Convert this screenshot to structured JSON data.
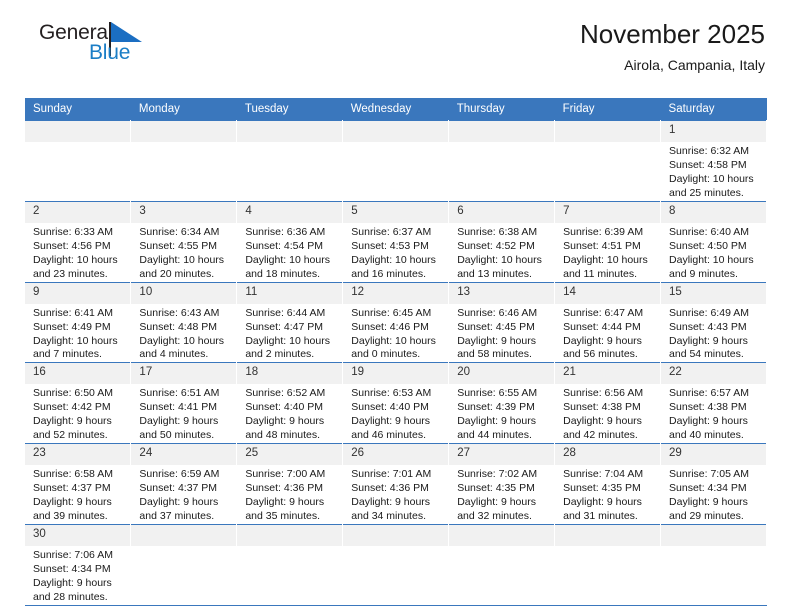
{
  "brand": {
    "name_top": "General",
    "name_bottom": "Blue",
    "accent_color": "#1b7ec6",
    "flag_icon": "general-blue-flag"
  },
  "header": {
    "title": "November 2025",
    "subtitle": "Airola, Campania, Italy"
  },
  "colors": {
    "header_blue": "#3a77bd",
    "daynum_gray": "#f1f1f1",
    "text": "#1a1a1a"
  },
  "weekdays": [
    "Sunday",
    "Monday",
    "Tuesday",
    "Wednesday",
    "Thursday",
    "Friday",
    "Saturday"
  ],
  "labels": {
    "sunrise": "Sunrise:",
    "sunset": "Sunset:",
    "daylight": "Daylight:"
  },
  "weeks": [
    [
      {
        "blank": true
      },
      {
        "blank": true
      },
      {
        "blank": true
      },
      {
        "blank": true
      },
      {
        "blank": true
      },
      {
        "blank": true
      },
      {
        "day": "1",
        "sunrise": "Sunrise: 6:32 AM",
        "sunset": "Sunset: 4:58 PM",
        "daylight1": "Daylight: 10 hours",
        "daylight2": "and 25 minutes."
      }
    ],
    [
      {
        "day": "2",
        "sunrise": "Sunrise: 6:33 AM",
        "sunset": "Sunset: 4:56 PM",
        "daylight1": "Daylight: 10 hours",
        "daylight2": "and 23 minutes."
      },
      {
        "day": "3",
        "sunrise": "Sunrise: 6:34 AM",
        "sunset": "Sunset: 4:55 PM",
        "daylight1": "Daylight: 10 hours",
        "daylight2": "and 20 minutes."
      },
      {
        "day": "4",
        "sunrise": "Sunrise: 6:36 AM",
        "sunset": "Sunset: 4:54 PM",
        "daylight1": "Daylight: 10 hours",
        "daylight2": "and 18 minutes."
      },
      {
        "day": "5",
        "sunrise": "Sunrise: 6:37 AM",
        "sunset": "Sunset: 4:53 PM",
        "daylight1": "Daylight: 10 hours",
        "daylight2": "and 16 minutes."
      },
      {
        "day": "6",
        "sunrise": "Sunrise: 6:38 AM",
        "sunset": "Sunset: 4:52 PM",
        "daylight1": "Daylight: 10 hours",
        "daylight2": "and 13 minutes."
      },
      {
        "day": "7",
        "sunrise": "Sunrise: 6:39 AM",
        "sunset": "Sunset: 4:51 PM",
        "daylight1": "Daylight: 10 hours",
        "daylight2": "and 11 minutes."
      },
      {
        "day": "8",
        "sunrise": "Sunrise: 6:40 AM",
        "sunset": "Sunset: 4:50 PM",
        "daylight1": "Daylight: 10 hours",
        "daylight2": "and 9 minutes."
      }
    ],
    [
      {
        "day": "9",
        "sunrise": "Sunrise: 6:41 AM",
        "sunset": "Sunset: 4:49 PM",
        "daylight1": "Daylight: 10 hours",
        "daylight2": "and 7 minutes."
      },
      {
        "day": "10",
        "sunrise": "Sunrise: 6:43 AM",
        "sunset": "Sunset: 4:48 PM",
        "daylight1": "Daylight: 10 hours",
        "daylight2": "and 4 minutes."
      },
      {
        "day": "11",
        "sunrise": "Sunrise: 6:44 AM",
        "sunset": "Sunset: 4:47 PM",
        "daylight1": "Daylight: 10 hours",
        "daylight2": "and 2 minutes."
      },
      {
        "day": "12",
        "sunrise": "Sunrise: 6:45 AM",
        "sunset": "Sunset: 4:46 PM",
        "daylight1": "Daylight: 10 hours",
        "daylight2": "and 0 minutes."
      },
      {
        "day": "13",
        "sunrise": "Sunrise: 6:46 AM",
        "sunset": "Sunset: 4:45 PM",
        "daylight1": "Daylight: 9 hours",
        "daylight2": "and 58 minutes."
      },
      {
        "day": "14",
        "sunrise": "Sunrise: 6:47 AM",
        "sunset": "Sunset: 4:44 PM",
        "daylight1": "Daylight: 9 hours",
        "daylight2": "and 56 minutes."
      },
      {
        "day": "15",
        "sunrise": "Sunrise: 6:49 AM",
        "sunset": "Sunset: 4:43 PM",
        "daylight1": "Daylight: 9 hours",
        "daylight2": "and 54 minutes."
      }
    ],
    [
      {
        "day": "16",
        "sunrise": "Sunrise: 6:50 AM",
        "sunset": "Sunset: 4:42 PM",
        "daylight1": "Daylight: 9 hours",
        "daylight2": "and 52 minutes."
      },
      {
        "day": "17",
        "sunrise": "Sunrise: 6:51 AM",
        "sunset": "Sunset: 4:41 PM",
        "daylight1": "Daylight: 9 hours",
        "daylight2": "and 50 minutes."
      },
      {
        "day": "18",
        "sunrise": "Sunrise: 6:52 AM",
        "sunset": "Sunset: 4:40 PM",
        "daylight1": "Daylight: 9 hours",
        "daylight2": "and 48 minutes."
      },
      {
        "day": "19",
        "sunrise": "Sunrise: 6:53 AM",
        "sunset": "Sunset: 4:40 PM",
        "daylight1": "Daylight: 9 hours",
        "daylight2": "and 46 minutes."
      },
      {
        "day": "20",
        "sunrise": "Sunrise: 6:55 AM",
        "sunset": "Sunset: 4:39 PM",
        "daylight1": "Daylight: 9 hours",
        "daylight2": "and 44 minutes."
      },
      {
        "day": "21",
        "sunrise": "Sunrise: 6:56 AM",
        "sunset": "Sunset: 4:38 PM",
        "daylight1": "Daylight: 9 hours",
        "daylight2": "and 42 minutes."
      },
      {
        "day": "22",
        "sunrise": "Sunrise: 6:57 AM",
        "sunset": "Sunset: 4:38 PM",
        "daylight1": "Daylight: 9 hours",
        "daylight2": "and 40 minutes."
      }
    ],
    [
      {
        "day": "23",
        "sunrise": "Sunrise: 6:58 AM",
        "sunset": "Sunset: 4:37 PM",
        "daylight1": "Daylight: 9 hours",
        "daylight2": "and 39 minutes."
      },
      {
        "day": "24",
        "sunrise": "Sunrise: 6:59 AM",
        "sunset": "Sunset: 4:37 PM",
        "daylight1": "Daylight: 9 hours",
        "daylight2": "and 37 minutes."
      },
      {
        "day": "25",
        "sunrise": "Sunrise: 7:00 AM",
        "sunset": "Sunset: 4:36 PM",
        "daylight1": "Daylight: 9 hours",
        "daylight2": "and 35 minutes."
      },
      {
        "day": "26",
        "sunrise": "Sunrise: 7:01 AM",
        "sunset": "Sunset: 4:36 PM",
        "daylight1": "Daylight: 9 hours",
        "daylight2": "and 34 minutes."
      },
      {
        "day": "27",
        "sunrise": "Sunrise: 7:02 AM",
        "sunset": "Sunset: 4:35 PM",
        "daylight1": "Daylight: 9 hours",
        "daylight2": "and 32 minutes."
      },
      {
        "day": "28",
        "sunrise": "Sunrise: 7:04 AM",
        "sunset": "Sunset: 4:35 PM",
        "daylight1": "Daylight: 9 hours",
        "daylight2": "and 31 minutes."
      },
      {
        "day": "29",
        "sunrise": "Sunrise: 7:05 AM",
        "sunset": "Sunset: 4:34 PM",
        "daylight1": "Daylight: 9 hours",
        "daylight2": "and 29 minutes."
      }
    ],
    [
      {
        "day": "30",
        "sunrise": "Sunrise: 7:06 AM",
        "sunset": "Sunset: 4:34 PM",
        "daylight1": "Daylight: 9 hours",
        "daylight2": "and 28 minutes."
      },
      {
        "blank": true
      },
      {
        "blank": true
      },
      {
        "blank": true
      },
      {
        "blank": true
      },
      {
        "blank": true
      },
      {
        "blank": true
      }
    ]
  ]
}
